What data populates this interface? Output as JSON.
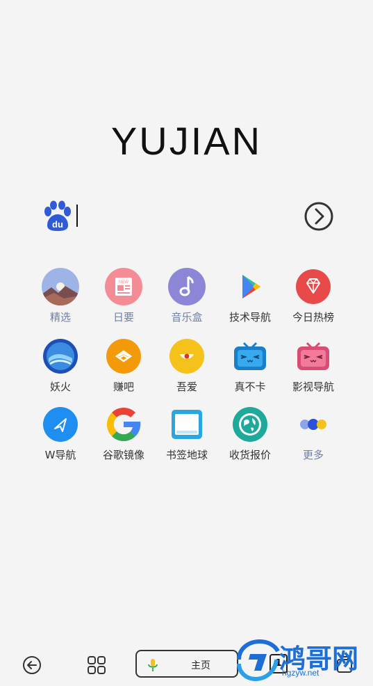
{
  "header": {
    "logo_text": "YUJIAN"
  },
  "search": {
    "engine_icon": "baidu-paw-icon",
    "engine_text": "du",
    "go_icon": "chevron-right-circle-icon"
  },
  "grid": [
    {
      "label": "精选",
      "icon": "landscape-icon",
      "accent": true
    },
    {
      "label": "日要",
      "icon": "news-icon",
      "badge": "NEW",
      "accent": true
    },
    {
      "label": "音乐盒",
      "icon": "music-note-icon",
      "accent": true
    },
    {
      "label": "技术导航",
      "icon": "play-store-icon",
      "accent": false
    },
    {
      "label": "今日热榜",
      "icon": "diamond-icon",
      "accent": false
    },
    {
      "label": "妖火",
      "icon": "wave-globe-icon",
      "accent": false
    },
    {
      "label": "赚吧",
      "icon": "wings-icon",
      "accent": false
    },
    {
      "label": "吾爱",
      "icon": "smile-icon",
      "accent": false
    },
    {
      "label": "真不卡",
      "icon": "tv-face-blue-icon",
      "accent": false
    },
    {
      "label": "影视导航",
      "icon": "tv-face-pink-icon",
      "accent": false
    },
    {
      "label": "W导航",
      "icon": "paper-plane-icon",
      "accent": false
    },
    {
      "label": "谷歌镜像",
      "icon": "google-icon",
      "accent": false
    },
    {
      "label": "书签地球",
      "icon": "bookmark-card-icon",
      "accent": false
    },
    {
      "label": "收货报价",
      "icon": "globe-icon",
      "accent": false
    },
    {
      "label": "更多",
      "icon": "more-dots-icon",
      "accent": true
    }
  ],
  "bottom": {
    "back_icon": "back-arrow-icon",
    "apps_icon": "grid-icon",
    "home_label": "主页",
    "mic_icon": "microphone-icon",
    "tab_count": "1",
    "menu_icon": "menu-icon"
  },
  "watermark": {
    "title": "鸿哥网",
    "url": "hgzyw.net"
  },
  "colors": {
    "bg": "#f4f4f4",
    "accent_label": "#6f7fa6",
    "baidu_blue": "#2f5bd7"
  }
}
